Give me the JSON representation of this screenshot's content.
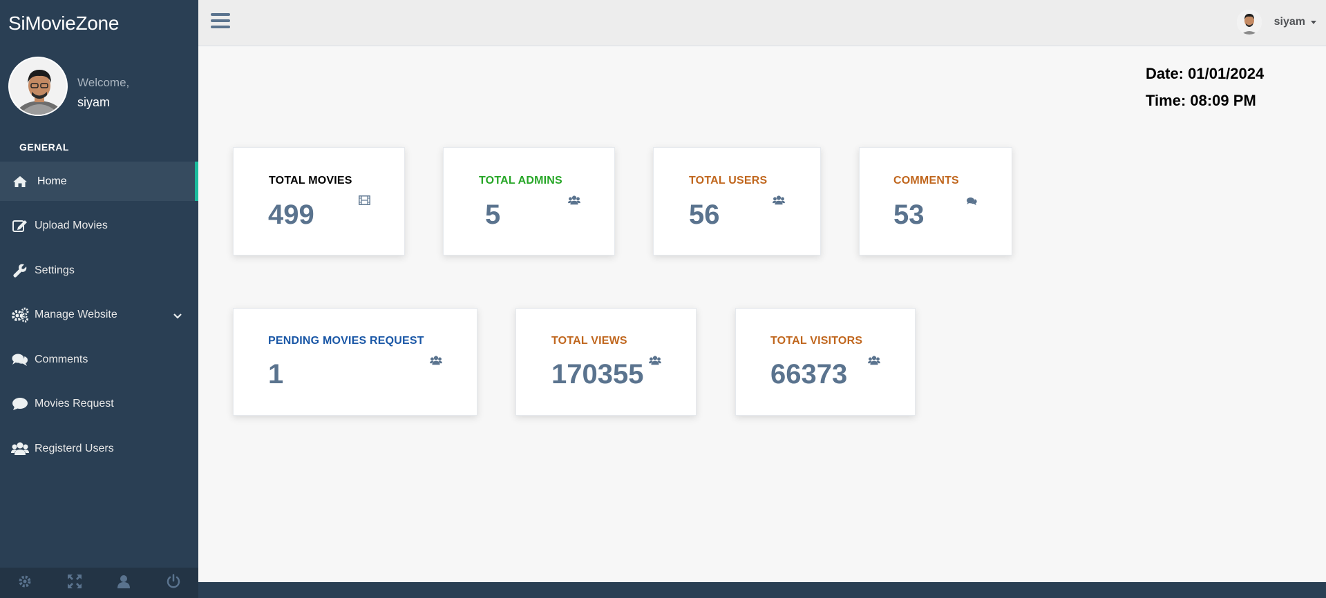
{
  "app": {
    "brand": "SiMovieZone"
  },
  "sidebar": {
    "welcome": "Welcome,",
    "user_name": "siyam",
    "section": "GENERAL",
    "items": [
      {
        "label": "Home",
        "icon": "home-icon",
        "active": true
      },
      {
        "label": "Upload Movies",
        "icon": "edit-icon"
      },
      {
        "label": "Settings",
        "icon": "wrench-icon"
      },
      {
        "label": "Manage Website",
        "icon": "gears-icon",
        "has_submenu": true
      },
      {
        "label": "Comments",
        "icon": "comments-icon"
      },
      {
        "label": "Movies Request",
        "icon": "comment-icon"
      },
      {
        "label": "Registerd Users",
        "icon": "users-icon"
      }
    ],
    "footer_icons": [
      "gear-icon",
      "fullscreen-icon",
      "user-icon",
      "power-icon"
    ]
  },
  "topbar": {
    "user_name": "siyam"
  },
  "datetime": {
    "date": "Date: 01/01/2024",
    "time": "Time: 08:09 PM"
  },
  "stats": [
    {
      "label": "TOTAL MOVIES",
      "value": "499",
      "color": "#000000",
      "icon": "film-icon"
    },
    {
      "label": "TOTAL ADMINS",
      "value": "5",
      "color": "#26a626",
      "icon": "users-icon"
    },
    {
      "label": "TOTAL USERS",
      "value": "56",
      "color": "#c0661d",
      "icon": "users-icon"
    },
    {
      "label": "COMMENTS",
      "value": "53",
      "color": "#c0661d",
      "icon": "comments-icon"
    },
    {
      "label": "PENDING MOVIES REQUEST",
      "value": "1",
      "color": "#1a57a6",
      "icon": "users-icon"
    },
    {
      "label": "TOTAL VIEWS",
      "value": "170355",
      "color": "#c0661d",
      "icon": "users-icon"
    },
    {
      "label": "TOTAL VISITORS",
      "value": "66373",
      "color": "#c0661d",
      "icon": "users-icon"
    }
  ],
  "colors": {
    "sidebar_bg": "#2a3f54",
    "accent": "#1abb9c",
    "value_color": "#5a738e"
  }
}
